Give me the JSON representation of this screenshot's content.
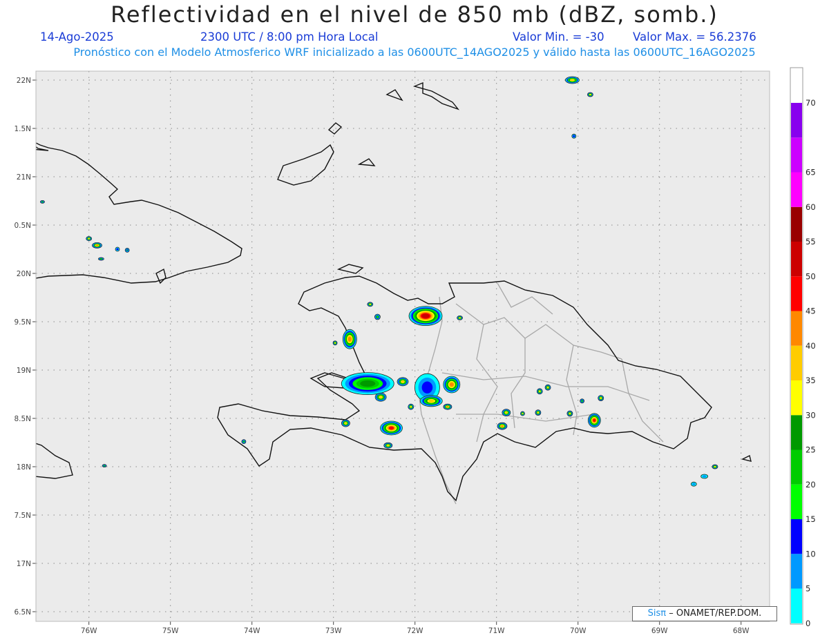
{
  "header": {
    "title": "Reflectividad en el nivel de 850 mb (dBZ, somb.)",
    "date": "14-Ago-2025",
    "time": "2300 UTC / 8:00 pm Hora Local",
    "min_label": "Valor Min. = -30",
    "max_label": "Valor Max. = 56.2376",
    "model_line": "Pronóstico con el Modelo Atmosferico WRF inicializado a las 0600UTC_14AGO2025 y válido hasta las  0600UTC_16AGO2025"
  },
  "credit": {
    "brand": "Sisπ",
    "text": "– ONAMET/REP.DOM."
  },
  "map": {
    "lon_range": [
      -76.65,
      -67.65
    ],
    "lat_range": [
      17.42,
      22.05
    ],
    "lon_ticks": [
      {
        "value": -76,
        "label": "76W"
      },
      {
        "value": -75,
        "label": "75W"
      },
      {
        "value": -74,
        "label": "74W"
      },
      {
        "value": -73,
        "label": "73W"
      },
      {
        "value": -72,
        "label": "72W"
      },
      {
        "value": -71,
        "label": "71W"
      },
      {
        "value": -70,
        "label": "70W"
      },
      {
        "value": -69,
        "label": "69W"
      },
      {
        "value": -68,
        "label": "68W"
      }
    ],
    "lat_ticks": [
      {
        "value": 22,
        "label": "22N"
      },
      {
        "value": 21.5,
        "label": "1.5N"
      },
      {
        "value": 21,
        "label": "21N"
      },
      {
        "value": 20.5,
        "label": "0.5N"
      },
      {
        "value": 20,
        "label": "20N"
      },
      {
        "value": 19.5,
        "label": "9.5N"
      },
      {
        "value": 19,
        "label": "19N"
      },
      {
        "value": 18.5,
        "label": "8.5N"
      },
      {
        "value": 18,
        "label": "18N"
      },
      {
        "value": 17.5,
        "label": "7.5N"
      },
      {
        "value": 17,
        "label": "17N"
      },
      {
        "value": 16.5,
        "label": "6.5N"
      }
    ],
    "colors": {
      "background": "#ebebeb",
      "grid": "#888888",
      "coast": "#111111",
      "borders": "#a8a8a8"
    }
  },
  "colorbar": {
    "labels": [
      "0",
      "5",
      "10",
      "15",
      "20",
      "25",
      "30",
      "35",
      "40",
      "45",
      "50",
      "55",
      "60",
      "65",
      "70"
    ],
    "colors": [
      "#00ffff",
      "#0099ff",
      "#0000ff",
      "#00ff00",
      "#00cc00",
      "#009900",
      "#ffff00",
      "#ffcc00",
      "#ff8800",
      "#ff0000",
      "#cc0000",
      "#990000",
      "#ff00ff",
      "#cc00ff",
      "#8800ee"
    ]
  },
  "cells": [
    {
      "lon": -72.58,
      "lat": 18.86,
      "rx": 38,
      "ry": 16,
      "level": 5
    },
    {
      "lon": -72.8,
      "lat": 19.32,
      "rx": 10,
      "ry": 14,
      "level": 8
    },
    {
      "lon": -72.29,
      "lat": 18.4,
      "rx": 16,
      "ry": 10,
      "level": 9
    },
    {
      "lon": -71.87,
      "lat": 19.56,
      "rx": 24,
      "ry": 14,
      "level": 10
    },
    {
      "lon": -71.85,
      "lat": 18.82,
      "rx": 18,
      "ry": 20,
      "level": 2
    },
    {
      "lon": -71.55,
      "lat": 18.85,
      "rx": 12,
      "ry": 12,
      "level": 8
    },
    {
      "lon": -71.8,
      "lat": 18.68,
      "rx": 16,
      "ry": 8,
      "level": 7
    },
    {
      "lon": -72.42,
      "lat": 18.72,
      "rx": 8,
      "ry": 6,
      "level": 7
    },
    {
      "lon": -72.15,
      "lat": 18.88,
      "rx": 8,
      "ry": 6,
      "level": 7
    },
    {
      "lon": -72.33,
      "lat": 18.22,
      "rx": 6,
      "ry": 4,
      "level": 7
    },
    {
      "lon": -72.85,
      "lat": 18.45,
      "rx": 6,
      "ry": 5,
      "level": 7
    },
    {
      "lon": -70.88,
      "lat": 18.56,
      "rx": 6,
      "ry": 5,
      "level": 7
    },
    {
      "lon": -70.93,
      "lat": 18.42,
      "rx": 7,
      "ry": 5,
      "level": 8
    },
    {
      "lon": -69.8,
      "lat": 18.48,
      "rx": 9,
      "ry": 10,
      "level": 9
    },
    {
      "lon": -70.37,
      "lat": 18.82,
      "rx": 4,
      "ry": 4,
      "level": 7
    },
    {
      "lon": -70.07,
      "lat": 22.0,
      "rx": 10,
      "ry": 5,
      "level": 7
    },
    {
      "lon": -69.85,
      "lat": 21.85,
      "rx": 4,
      "ry": 3,
      "level": 7
    },
    {
      "lon": -70.05,
      "lat": 21.42,
      "rx": 3,
      "ry": 3,
      "level": 2
    },
    {
      "lon": -76.0,
      "lat": 20.36,
      "rx": 4,
      "ry": 3,
      "level": 7
    },
    {
      "lon": -75.9,
      "lat": 20.29,
      "rx": 7,
      "ry": 4,
      "level": 8
    },
    {
      "lon": -75.65,
      "lat": 20.25,
      "rx": 3,
      "ry": 3,
      "level": 2
    },
    {
      "lon": -75.85,
      "lat": 20.15,
      "rx": 4,
      "ry": 2,
      "level": 4
    },
    {
      "lon": -72.46,
      "lat": 19.55,
      "rx": 4,
      "ry": 4,
      "level": 4
    },
    {
      "lon": -72.55,
      "lat": 19.68,
      "rx": 4,
      "ry": 3,
      "level": 7
    },
    {
      "lon": -72.98,
      "lat": 19.28,
      "rx": 3,
      "ry": 3,
      "level": 7
    },
    {
      "lon": -71.45,
      "lat": 19.54,
      "rx": 4,
      "ry": 3,
      "level": 7
    },
    {
      "lon": -70.1,
      "lat": 18.55,
      "rx": 4,
      "ry": 4,
      "level": 7
    },
    {
      "lon": -70.49,
      "lat": 18.56,
      "rx": 4,
      "ry": 4,
      "level": 7
    },
    {
      "lon": -70.68,
      "lat": 18.55,
      "rx": 3,
      "ry": 3,
      "level": 7
    },
    {
      "lon": -70.47,
      "lat": 18.78,
      "rx": 4,
      "ry": 4,
      "level": 7
    },
    {
      "lon": -69.72,
      "lat": 18.71,
      "rx": 4,
      "ry": 4,
      "level": 7
    },
    {
      "lon": -69.95,
      "lat": 18.68,
      "rx": 3,
      "ry": 3,
      "level": 4
    },
    {
      "lon": -68.32,
      "lat": 18.0,
      "rx": 4,
      "ry": 3,
      "level": 7
    },
    {
      "lon": -68.45,
      "lat": 17.9,
      "rx": 5,
      "ry": 3,
      "level": 1
    },
    {
      "lon": -68.58,
      "lat": 17.82,
      "rx": 4,
      "ry": 3,
      "level": 1
    },
    {
      "lon": -74.1,
      "lat": 18.26,
      "rx": 3,
      "ry": 3,
      "level": 4
    },
    {
      "lon": -75.81,
      "lat": 18.01,
      "rx": 3,
      "ry": 2,
      "level": 4
    },
    {
      "lon": -76.57,
      "lat": 20.74,
      "rx": 3,
      "ry": 2,
      "level": 4
    },
    {
      "lon": -75.53,
      "lat": 20.24,
      "rx": 3,
      "ry": 3,
      "level": 3
    },
    {
      "lon": -72.05,
      "lat": 18.62,
      "rx": 4,
      "ry": 4,
      "level": 7
    },
    {
      "lon": -71.6,
      "lat": 18.62,
      "rx": 6,
      "ry": 4,
      "level": 8
    }
  ]
}
